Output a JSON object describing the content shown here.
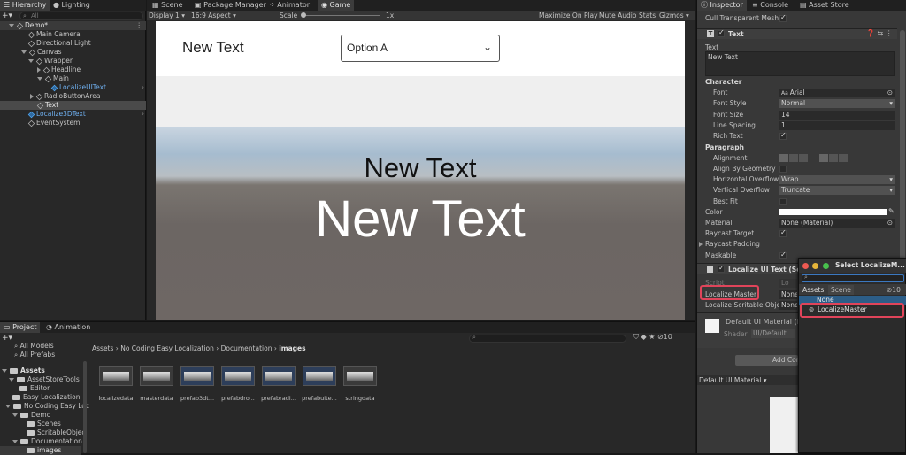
{
  "hierarchy": {
    "tab": "Hierarchy",
    "tab2": "Lighting",
    "search_placeholder": "All",
    "items": [
      {
        "label": "Demo*"
      },
      {
        "label": "Main Camera"
      },
      {
        "label": "Directional Light"
      },
      {
        "label": "Canvas"
      },
      {
        "label": "Wrapper"
      },
      {
        "label": "Headline"
      },
      {
        "label": "Main"
      },
      {
        "label": "LocalizeUIText"
      },
      {
        "label": "RadioButtonArea"
      },
      {
        "label": "Text"
      },
      {
        "label": "Localize3DText"
      },
      {
        "label": "EventSystem"
      }
    ]
  },
  "scene_tabs": [
    {
      "label": "Scene"
    },
    {
      "label": "Package Manager"
    },
    {
      "label": "Animator"
    },
    {
      "label": "Game"
    }
  ],
  "game_toolbar": {
    "display": "Display 1",
    "aspect": "16:9 Aspect",
    "scale_label": "Scale",
    "scale_value": "1x",
    "maximize": "Maximize On Play",
    "mute": "Mute Audio",
    "stats": "Stats",
    "gizmos": "Gizmos"
  },
  "game_view": {
    "headline_text": "New Text",
    "dropdown_value": "Option A",
    "text_3d_small": "New Text",
    "text_3d_large": "New Text"
  },
  "inspector": {
    "tab": "Inspector",
    "tab2": "Console",
    "tab3": "Asset Store",
    "cull_label": "Cull Transparent Mesh",
    "component_title": "Text",
    "text_label": "Text",
    "text_value": "New Text",
    "character_header": "Character",
    "font_label": "Font",
    "font_value": "Arial",
    "font_style_label": "Font Style",
    "font_style_value": "Normal",
    "font_size_label": "Font Size",
    "font_size_value": "14",
    "line_spacing_label": "Line Spacing",
    "line_spacing_value": "1",
    "rich_text_label": "Rich Text",
    "paragraph_header": "Paragraph",
    "alignment_label": "Alignment",
    "align_geometry_label": "Align By Geometry",
    "h_overflow_label": "Horizontal Overflow",
    "h_overflow_value": "Wrap",
    "v_overflow_label": "Vertical Overflow",
    "v_overflow_value": "Truncate",
    "best_fit_label": "Best Fit",
    "color_label": "Color",
    "material_label": "Material",
    "material_value": "None (Material)",
    "raycast_target_label": "Raycast Target",
    "raycast_padding_label": "Raycast Padding",
    "maskable_label": "Maskable",
    "localize_component_title": "Localize UI Text (Scrip",
    "script_label": "Script",
    "localize_master_label": "Localize Master",
    "localize_master_value": "None",
    "localize_scriptable_label": "Localize Scritable Objec",
    "localize_scriptable_value": "None",
    "default_material_title": "Default UI Material (M",
    "shader_label": "Shader",
    "shader_value": "UI/Default",
    "add_component": "Add Com",
    "material_footer": "Default UI Material"
  },
  "picker": {
    "title": "Select LocalizeM...",
    "tab_assets": "Assets",
    "tab_scene": "Scene",
    "count": "10",
    "option_none": "None",
    "option_master": "LocalizeMaster"
  },
  "project": {
    "tab": "Project",
    "tab2": "Animation",
    "favorites": [
      {
        "label": "All Models"
      },
      {
        "label": "All Prefabs"
      }
    ],
    "tree": [
      {
        "label": "Assets"
      },
      {
        "label": "AssetStoreTools"
      },
      {
        "label": "Editor"
      },
      {
        "label": "Easy Localization"
      },
      {
        "label": "No Coding Easy Loc"
      },
      {
        "label": "Demo"
      },
      {
        "label": "Scenes"
      },
      {
        "label": "ScritableObjec"
      },
      {
        "label": "Documentation"
      },
      {
        "label": "images"
      }
    ],
    "breadcrumb": [
      {
        "label": "Assets"
      },
      {
        "label": "No Coding Easy Localization"
      },
      {
        "label": "Documentation"
      },
      {
        "label": "images"
      }
    ],
    "hidden_count": "10",
    "files": [
      {
        "label": "localizedata"
      },
      {
        "label": "masterdata"
      },
      {
        "label": "prefab3dt..."
      },
      {
        "label": "prefabdro..."
      },
      {
        "label": "prefabradi..."
      },
      {
        "label": "prefabuite..."
      },
      {
        "label": "stringdata"
      }
    ]
  },
  "colors": {
    "highlight": "#e0445a",
    "selection": "#2c5d87",
    "link_blue": "#4fa0e8"
  }
}
